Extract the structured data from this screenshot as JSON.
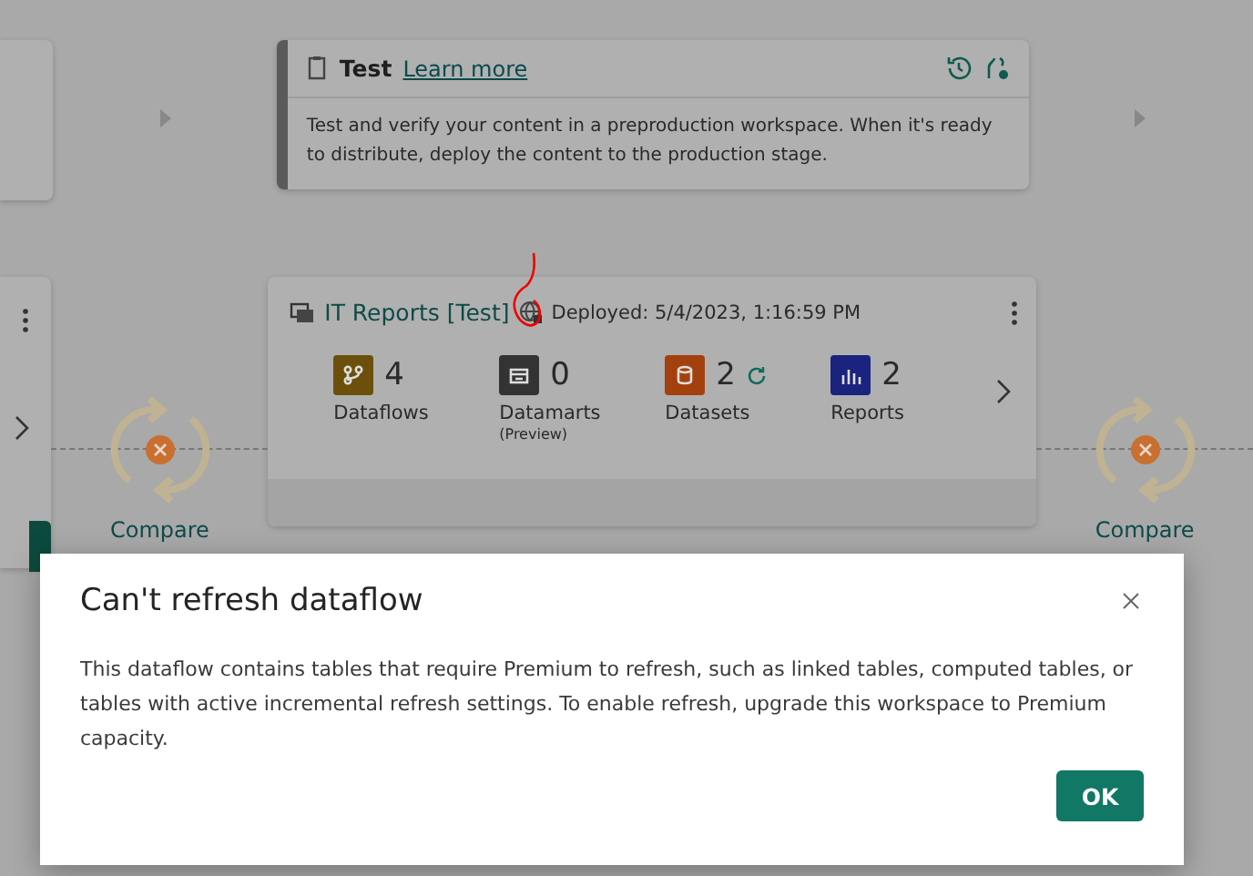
{
  "stage_header": {
    "title": "Test",
    "link": "Learn more",
    "description": "Test and verify your content in a preproduction workspace. When it's ready to distribute, deploy the content to the production stage."
  },
  "workspace_card": {
    "name": "IT Reports [Test]",
    "deployed": "Deployed: 5/4/2023, 1:16:59 PM",
    "items": [
      {
        "kind": "dataflow",
        "count": "4",
        "label": "Dataflows",
        "color": "#6b4f0a"
      },
      {
        "kind": "datamart",
        "count": "0",
        "label": "Datamarts",
        "note": "(Preview)",
        "color": "#333333"
      },
      {
        "kind": "dataset",
        "count": "2",
        "label": "Datasets",
        "color": "#a3410e",
        "refresh": true
      },
      {
        "kind": "report",
        "count": "2",
        "label": "Reports",
        "color": "#1a237e"
      }
    ]
  },
  "compare": [
    "Compare",
    "Compare"
  ],
  "dialog": {
    "title": "Can't refresh dataflow",
    "message": "This dataflow contains tables that require Premium to refresh, such as linked tables, computed tables, or tables with active incremental refresh settings. To enable refresh, upgrade this workspace to Premium capacity.",
    "button": "OK"
  }
}
